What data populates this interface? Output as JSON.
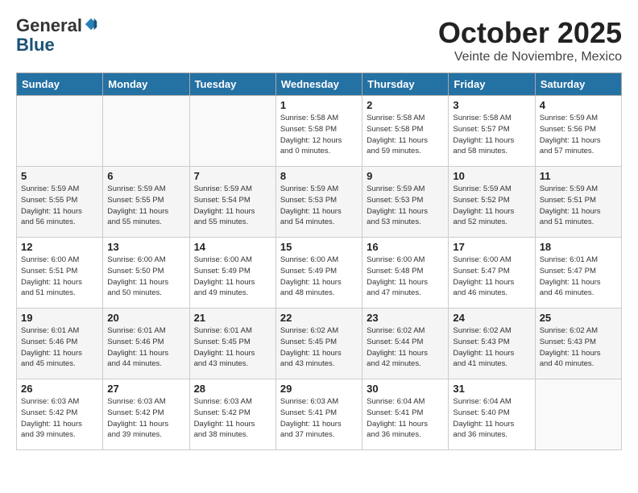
{
  "header": {
    "logo_line1": "General",
    "logo_line2": "Blue",
    "month": "October 2025",
    "location": "Veinte de Noviembre, Mexico"
  },
  "weekdays": [
    "Sunday",
    "Monday",
    "Tuesday",
    "Wednesday",
    "Thursday",
    "Friday",
    "Saturday"
  ],
  "weeks": [
    [
      {
        "day": "",
        "info": ""
      },
      {
        "day": "",
        "info": ""
      },
      {
        "day": "",
        "info": ""
      },
      {
        "day": "1",
        "info": "Sunrise: 5:58 AM\nSunset: 5:58 PM\nDaylight: 12 hours\nand 0 minutes."
      },
      {
        "day": "2",
        "info": "Sunrise: 5:58 AM\nSunset: 5:58 PM\nDaylight: 11 hours\nand 59 minutes."
      },
      {
        "day": "3",
        "info": "Sunrise: 5:58 AM\nSunset: 5:57 PM\nDaylight: 11 hours\nand 58 minutes."
      },
      {
        "day": "4",
        "info": "Sunrise: 5:59 AM\nSunset: 5:56 PM\nDaylight: 11 hours\nand 57 minutes."
      }
    ],
    [
      {
        "day": "5",
        "info": "Sunrise: 5:59 AM\nSunset: 5:55 PM\nDaylight: 11 hours\nand 56 minutes."
      },
      {
        "day": "6",
        "info": "Sunrise: 5:59 AM\nSunset: 5:55 PM\nDaylight: 11 hours\nand 55 minutes."
      },
      {
        "day": "7",
        "info": "Sunrise: 5:59 AM\nSunset: 5:54 PM\nDaylight: 11 hours\nand 55 minutes."
      },
      {
        "day": "8",
        "info": "Sunrise: 5:59 AM\nSunset: 5:53 PM\nDaylight: 11 hours\nand 54 minutes."
      },
      {
        "day": "9",
        "info": "Sunrise: 5:59 AM\nSunset: 5:53 PM\nDaylight: 11 hours\nand 53 minutes."
      },
      {
        "day": "10",
        "info": "Sunrise: 5:59 AM\nSunset: 5:52 PM\nDaylight: 11 hours\nand 52 minutes."
      },
      {
        "day": "11",
        "info": "Sunrise: 5:59 AM\nSunset: 5:51 PM\nDaylight: 11 hours\nand 51 minutes."
      }
    ],
    [
      {
        "day": "12",
        "info": "Sunrise: 6:00 AM\nSunset: 5:51 PM\nDaylight: 11 hours\nand 51 minutes."
      },
      {
        "day": "13",
        "info": "Sunrise: 6:00 AM\nSunset: 5:50 PM\nDaylight: 11 hours\nand 50 minutes."
      },
      {
        "day": "14",
        "info": "Sunrise: 6:00 AM\nSunset: 5:49 PM\nDaylight: 11 hours\nand 49 minutes."
      },
      {
        "day": "15",
        "info": "Sunrise: 6:00 AM\nSunset: 5:49 PM\nDaylight: 11 hours\nand 48 minutes."
      },
      {
        "day": "16",
        "info": "Sunrise: 6:00 AM\nSunset: 5:48 PM\nDaylight: 11 hours\nand 47 minutes."
      },
      {
        "day": "17",
        "info": "Sunrise: 6:00 AM\nSunset: 5:47 PM\nDaylight: 11 hours\nand 46 minutes."
      },
      {
        "day": "18",
        "info": "Sunrise: 6:01 AM\nSunset: 5:47 PM\nDaylight: 11 hours\nand 46 minutes."
      }
    ],
    [
      {
        "day": "19",
        "info": "Sunrise: 6:01 AM\nSunset: 5:46 PM\nDaylight: 11 hours\nand 45 minutes."
      },
      {
        "day": "20",
        "info": "Sunrise: 6:01 AM\nSunset: 5:46 PM\nDaylight: 11 hours\nand 44 minutes."
      },
      {
        "day": "21",
        "info": "Sunrise: 6:01 AM\nSunset: 5:45 PM\nDaylight: 11 hours\nand 43 minutes."
      },
      {
        "day": "22",
        "info": "Sunrise: 6:02 AM\nSunset: 5:45 PM\nDaylight: 11 hours\nand 43 minutes."
      },
      {
        "day": "23",
        "info": "Sunrise: 6:02 AM\nSunset: 5:44 PM\nDaylight: 11 hours\nand 42 minutes."
      },
      {
        "day": "24",
        "info": "Sunrise: 6:02 AM\nSunset: 5:43 PM\nDaylight: 11 hours\nand 41 minutes."
      },
      {
        "day": "25",
        "info": "Sunrise: 6:02 AM\nSunset: 5:43 PM\nDaylight: 11 hours\nand 40 minutes."
      }
    ],
    [
      {
        "day": "26",
        "info": "Sunrise: 6:03 AM\nSunset: 5:42 PM\nDaylight: 11 hours\nand 39 minutes."
      },
      {
        "day": "27",
        "info": "Sunrise: 6:03 AM\nSunset: 5:42 PM\nDaylight: 11 hours\nand 39 minutes."
      },
      {
        "day": "28",
        "info": "Sunrise: 6:03 AM\nSunset: 5:42 PM\nDaylight: 11 hours\nand 38 minutes."
      },
      {
        "day": "29",
        "info": "Sunrise: 6:03 AM\nSunset: 5:41 PM\nDaylight: 11 hours\nand 37 minutes."
      },
      {
        "day": "30",
        "info": "Sunrise: 6:04 AM\nSunset: 5:41 PM\nDaylight: 11 hours\nand 36 minutes."
      },
      {
        "day": "31",
        "info": "Sunrise: 6:04 AM\nSunset: 5:40 PM\nDaylight: 11 hours\nand 36 minutes."
      },
      {
        "day": "",
        "info": ""
      }
    ]
  ]
}
